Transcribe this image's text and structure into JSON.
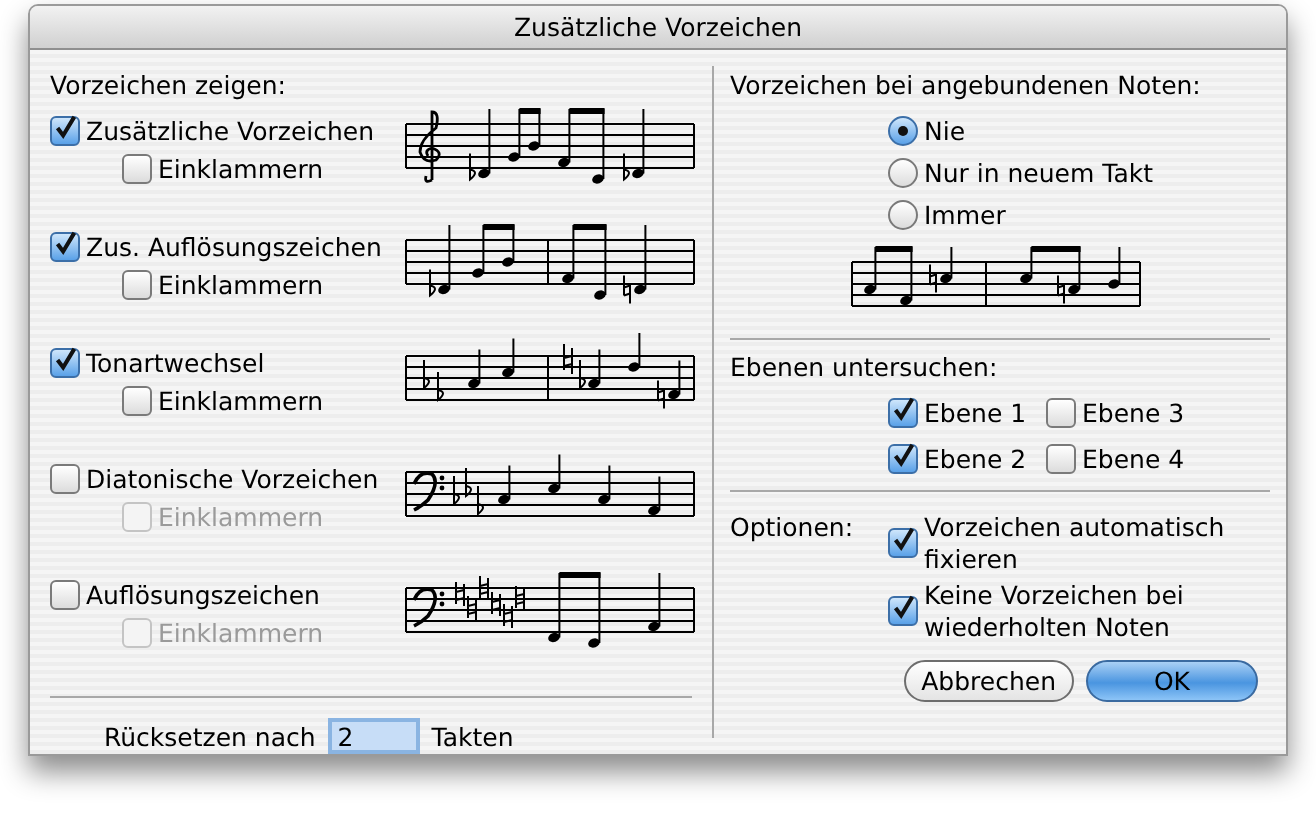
{
  "window": {
    "title": "Zusätzliche Vorzeichen"
  },
  "show_section": {
    "heading": "Vorzeichen zeigen:",
    "options": [
      {
        "label": "Zusätzliche Vorzeichen",
        "checked": true,
        "bracket": {
          "label": "Einklammern",
          "checked": false,
          "disabled": false
        }
      },
      {
        "label": "Zus. Auflösungszeichen",
        "checked": true,
        "bracket": {
          "label": "Einklammern",
          "checked": false,
          "disabled": false
        }
      },
      {
        "label": "Tonartwechsel",
        "checked": true,
        "bracket": {
          "label": "Einklammern",
          "checked": false,
          "disabled": false
        }
      },
      {
        "label": "Diatonische Vorzeichen",
        "checked": false,
        "bracket": {
          "label": "Einklammern",
          "checked": false,
          "disabled": true
        }
      },
      {
        "label": "Auflösungszeichen",
        "checked": false,
        "bracket": {
          "label": "Einklammern",
          "checked": false,
          "disabled": true
        }
      }
    ]
  },
  "reset": {
    "label": "Rücksetzen nach",
    "value": "2",
    "unit": "Takten"
  },
  "tied_notes": {
    "heading": "Vorzeichen bei angebundenen Noten:",
    "radios": [
      {
        "label": "Nie",
        "selected": true
      },
      {
        "label": "Nur in neuem Takt",
        "selected": false
      },
      {
        "label": "Immer",
        "selected": false
      }
    ]
  },
  "layers": {
    "heading": "Ebenen untersuchen:",
    "items": [
      {
        "label": "Ebene 1",
        "checked": true
      },
      {
        "label": "Ebene 3",
        "checked": false
      },
      {
        "label": "Ebene 2",
        "checked": true
      },
      {
        "label": "Ebene 4",
        "checked": false
      }
    ]
  },
  "options": {
    "label": "Optionen:",
    "items": [
      {
        "label": "Vorzeichen automatisch fixieren",
        "checked": true
      },
      {
        "label": "Keine Vorzeichen bei wiederholten Noten",
        "checked": true
      }
    ]
  },
  "buttons": [
    {
      "label": "Abbrechen",
      "default": false
    },
    {
      "label": "OK",
      "default": true
    }
  ]
}
